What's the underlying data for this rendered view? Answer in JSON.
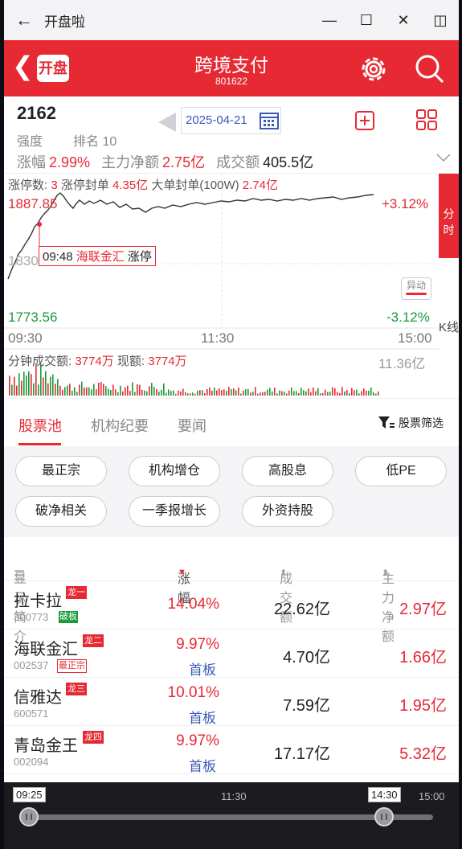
{
  "titlebar": {
    "title": "开盘啦"
  },
  "header": {
    "logo": "开盘",
    "title": "跨境支付",
    "code": "801622"
  },
  "info": {
    "strength_value": "2162",
    "strength_label": "强度",
    "rank_label": "排名 10",
    "date": "2025-04-21",
    "change_label": "涨幅",
    "change_value": "2.99%",
    "net_label": "主力净额",
    "net_value": "2.75亿",
    "turnover_label": "成交额",
    "turnover_value": "405.5亿"
  },
  "chart": {
    "limit_count_label": "涨停数:",
    "limit_count": "3",
    "seal_label": "涨停封单",
    "seal_value": "4.35亿",
    "big_seal_label": "大单封单(100W)",
    "big_seal_value": "2.74亿",
    "price_high": "1887.85",
    "price_mid": "1830.71",
    "price_low": "1773.56",
    "pct_high": "+3.12%",
    "pct_low": "-3.12%",
    "time_start": "09:30",
    "time_mid": "11:30",
    "time_end": "15:00",
    "side_tab": "分时",
    "k_tab": "K线",
    "anomaly_label": "异动",
    "tooltip_time": "09:48",
    "tooltip_stock": "海联金汇",
    "tooltip_event": "涨停",
    "vol_label": "分钟成交额:",
    "vol_value": "3774万",
    "vol_now_label": "现额:",
    "vol_now_value": "3774万",
    "vol_max": "11.36亿",
    "line_color": "#333333",
    "accent": "#e62933"
  },
  "tabs": {
    "items": [
      {
        "label": "股票池"
      },
      {
        "label": "机构纪要"
      },
      {
        "label": "要闻"
      }
    ],
    "filter": "股票筛选"
  },
  "tags": [
    "最正宗",
    "机构增仓",
    "高股息",
    "低PE",
    "破净相关",
    "一季报增长",
    "外资持股"
  ],
  "table": {
    "headers": {
      "name": "显示简介",
      "change": "涨幅",
      "amount": "成交额",
      "net": "主力净额"
    },
    "rows": [
      {
        "name": "拉卡拉",
        "badge": "龙一",
        "code": "300773",
        "tag": "破板",
        "change": "14.04%",
        "sub": "",
        "amount": "22.62亿",
        "net": "2.97亿"
      },
      {
        "name": "海联金汇",
        "badge": "龙二",
        "code": "002537",
        "tag": "最正宗",
        "change": "9.97%",
        "sub": "首板",
        "amount": "4.70亿",
        "net": "1.66亿"
      },
      {
        "name": "信雅达",
        "badge": "龙三",
        "code": "600571",
        "tag": "",
        "change": "10.01%",
        "sub": "首板",
        "amount": "7.59亿",
        "net": "1.95亿"
      },
      {
        "name": "青岛金王",
        "badge": "龙四",
        "code": "002094",
        "tag": "",
        "change": "9.97%",
        "sub": "首板",
        "amount": "17.17亿",
        "net": "5.32亿"
      }
    ]
  },
  "slider": {
    "start": "09:25",
    "mid": "11:30",
    "handle_right": "14:30",
    "end": "15:00",
    "range_start": "09:25",
    "range_end": "14:30"
  }
}
